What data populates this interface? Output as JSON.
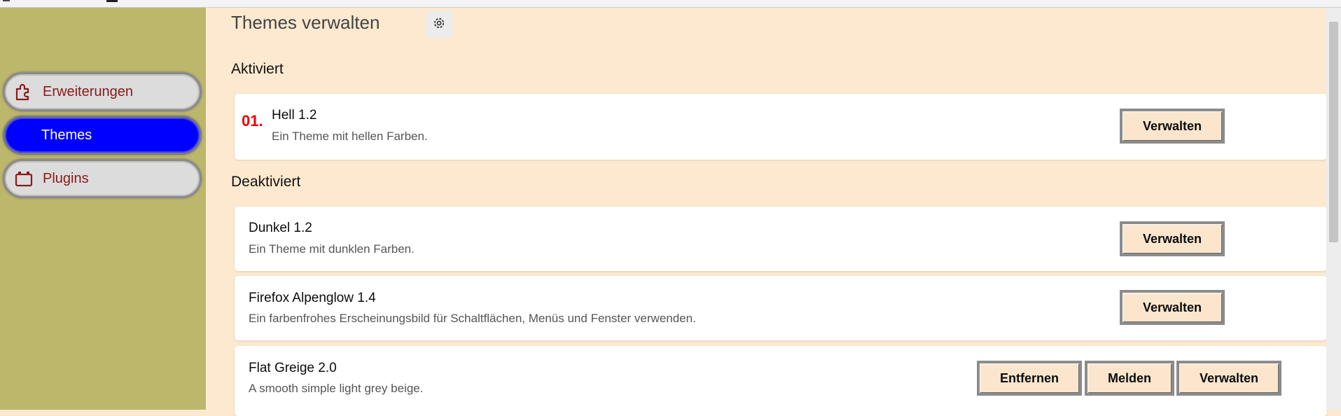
{
  "sidebar": {
    "items": [
      {
        "label": "Erweiterungen",
        "icon": "puzzle-icon"
      },
      {
        "label": "Themes",
        "icon": "themes-icon"
      },
      {
        "label": "Plugins",
        "icon": "plugin-icon"
      }
    ]
  },
  "main": {
    "title": "Themes verwalten",
    "sections": {
      "enabled": {
        "heading": "Aktiviert",
        "items": [
          {
            "number": "01.",
            "name": "Hell 1.2",
            "description": "Ein Theme mit hellen Farben.",
            "buttons": [
              "Verwalten"
            ]
          }
        ]
      },
      "disabled": {
        "heading": "Deaktiviert",
        "items": [
          {
            "name": "Dunkel 1.2",
            "description": "Ein Theme mit dunklen Farben.",
            "buttons": [
              "Verwalten"
            ]
          },
          {
            "name": "Firefox Alpenglow 1.4",
            "description": "Ein farbenfrohes Erscheinungsbild für Schaltflächen, Menüs und Fenster verwenden.",
            "buttons": [
              "Verwalten"
            ]
          },
          {
            "name": "Flat Greige 2.0",
            "description": "A smooth simple light grey beige.",
            "buttons": [
              "Entfernen",
              "Melden",
              "Verwalten"
            ]
          }
        ]
      }
    }
  },
  "colors": {
    "sidebar_bg": "#bdb76b",
    "content_bg": "#fde9cf",
    "active_nav": "#0000ff",
    "nav_text": "#8b1a1a",
    "number_red": "#ee0000",
    "button_bg": "#fbe6cd"
  }
}
